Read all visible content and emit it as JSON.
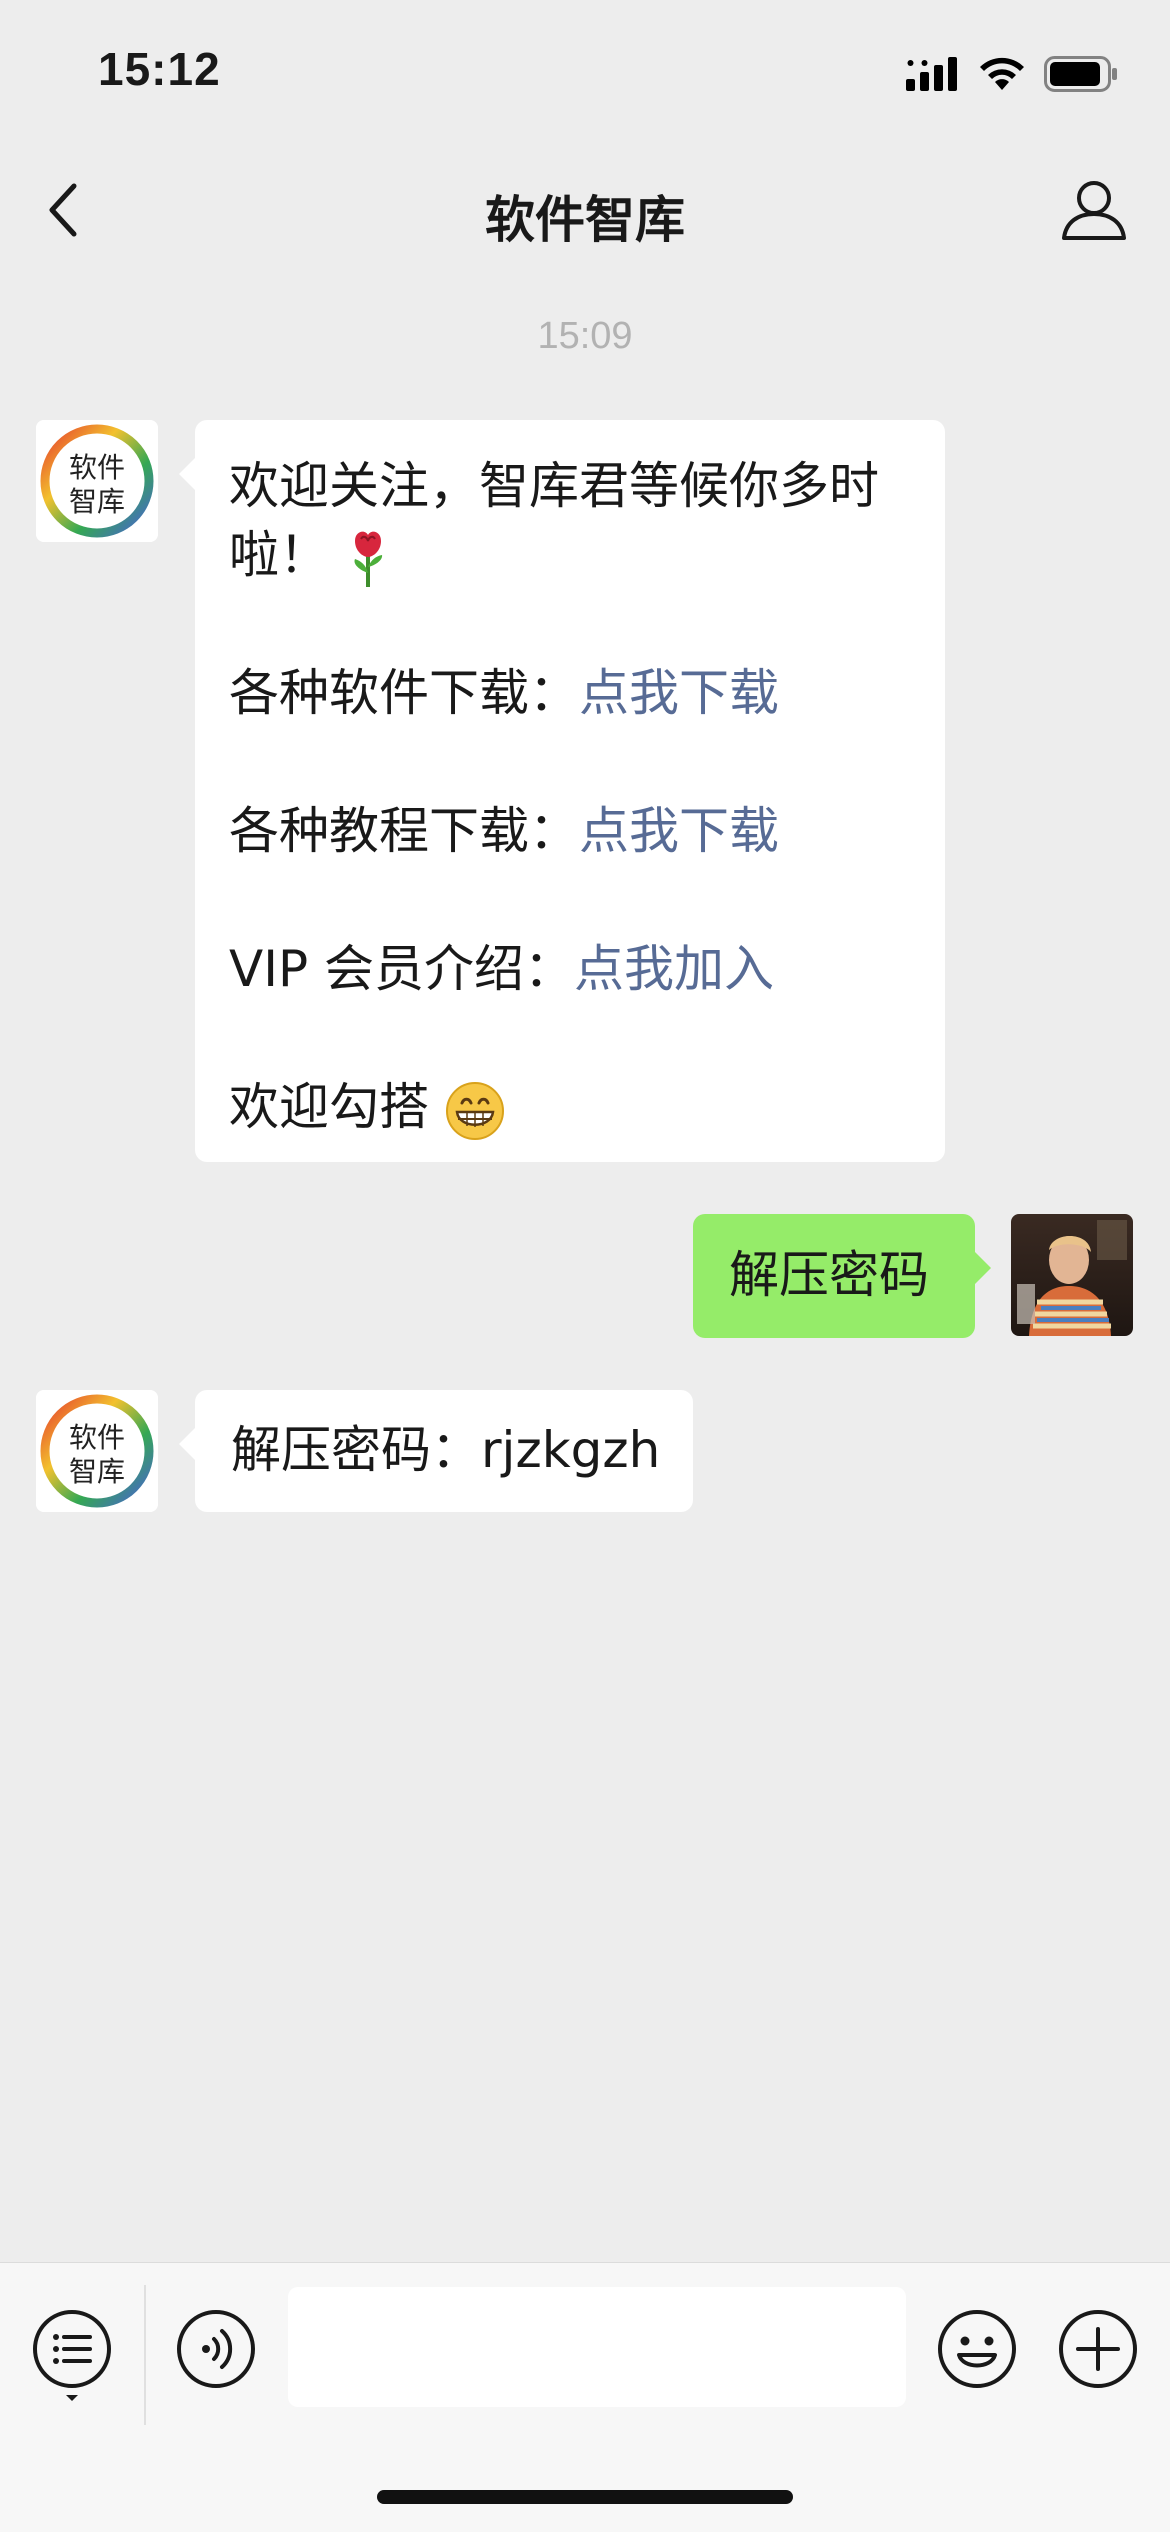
{
  "status_bar": {
    "time": "15:12"
  },
  "nav": {
    "title": "软件智库"
  },
  "chat": {
    "timestamp": "15:09",
    "welcome": {
      "line1": "欢迎关注，智库君等候你多时",
      "line2": "啦！",
      "software_label": "各种软件下载：",
      "software_link": "点我下载",
      "tutorial_label": "各种教程下载：",
      "tutorial_link": "点我下载",
      "vip_label": "VIP 会员介绍：",
      "vip_link": "点我加入",
      "closing": "欢迎勾搭"
    },
    "sent": {
      "text": "解压密码"
    },
    "reply": {
      "text": "解压密码：rjzkgzh"
    },
    "bot_avatar": {
      "line1": "软件",
      "line2": "智库"
    }
  },
  "icons": {
    "back": "chevron-left-icon",
    "profile": "person-icon",
    "menu": "list-icon",
    "voice": "voice-icon",
    "emoji": "smiley-icon",
    "plus": "plus-icon"
  },
  "colors": {
    "background": "#ededed",
    "bubble_in": "#ffffff",
    "bubble_out": "#95ec69",
    "link": "#576b95"
  }
}
